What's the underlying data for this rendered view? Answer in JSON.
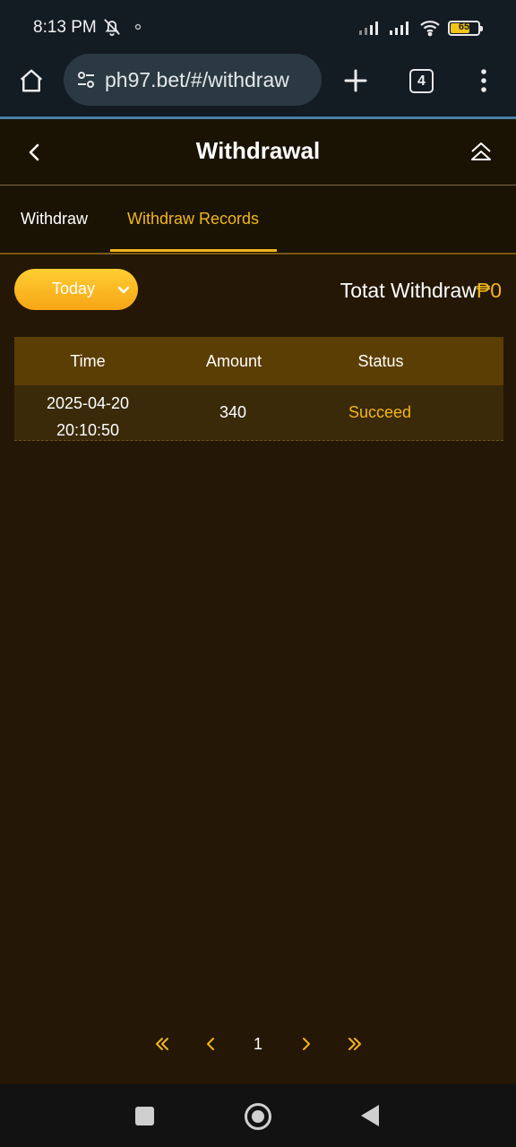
{
  "status_bar": {
    "time": "8:13 PM",
    "battery_level": "65"
  },
  "browser": {
    "url": "ph97.bet/#/withdraw",
    "tab_count": "4"
  },
  "header": {
    "title": "Withdrawal"
  },
  "tabs": [
    {
      "label": "Withdraw",
      "active": false
    },
    {
      "label": "Withdraw Records",
      "active": true
    }
  ],
  "filter": {
    "date_range": "Today",
    "total_label": "Totat Withdraw",
    "total_amount": "₱0"
  },
  "table": {
    "headers": [
      "Time",
      "Amount",
      "Status"
    ],
    "rows": [
      {
        "date": "2025-04-20",
        "time": "20:10:50",
        "amount": "340",
        "status": "Succeed"
      }
    ]
  },
  "pagination": {
    "current_page": "1"
  },
  "colors": {
    "accent": "#f3b51a",
    "background": "#241706",
    "table_header": "#5b3e03"
  }
}
